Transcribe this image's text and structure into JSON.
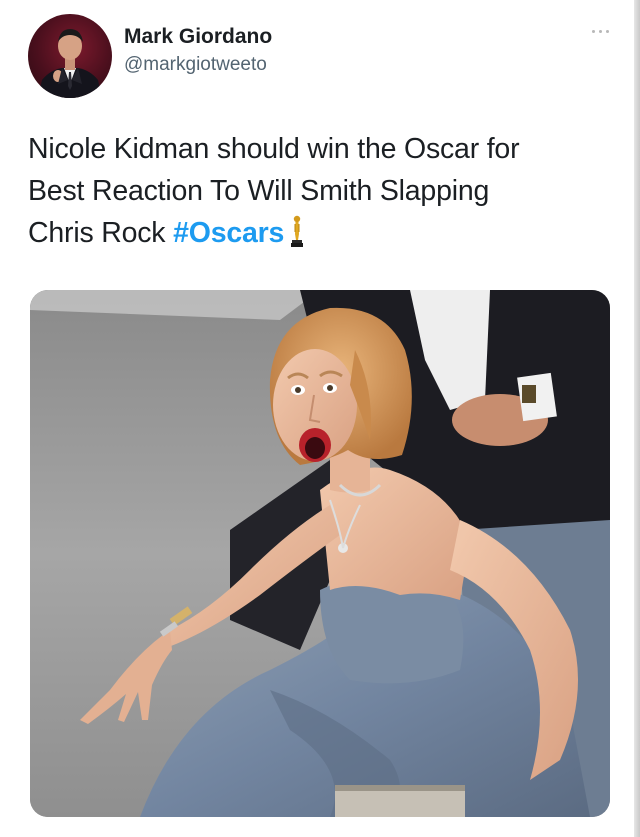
{
  "tweet": {
    "author": {
      "display_name": "Mark Giordano",
      "handle": "@markgiotweeto",
      "avatar_icon": "person-portrait-avatar"
    },
    "more_icon": "ellipsis-icon",
    "text_lines": [
      "Nicole Kidman should win the Oscar for",
      "Best Reaction To Will Smith Slapping",
      "Chris Rock "
    ],
    "hashtag": "#Oscars",
    "trailing_emoji": "oscar-trophy-emoji",
    "media": {
      "type": "photo",
      "subject": "woman in blue-grey strapless gown reacting with open mouth"
    }
  },
  "colors": {
    "text": "#1b1f23",
    "handle": "#536471",
    "hashtag": "#1d9bf0",
    "background": "#ffffff"
  }
}
